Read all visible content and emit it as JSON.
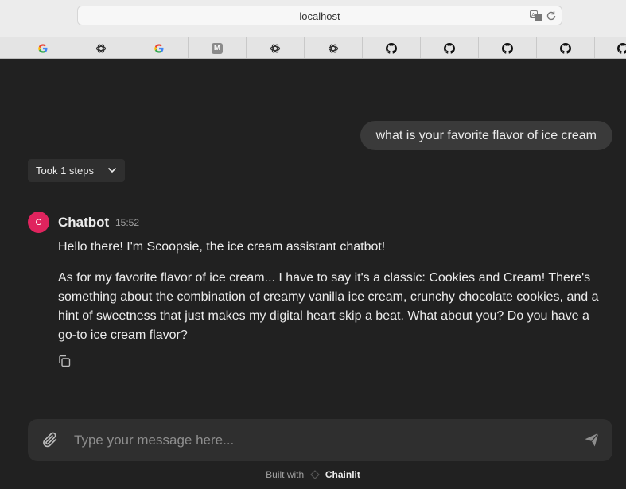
{
  "browser": {
    "url": "localhost",
    "bookmarks": [
      {
        "icon": "google-icon"
      },
      {
        "icon": "openai-icon"
      },
      {
        "icon": "google-icon"
      },
      {
        "icon": "m-icon",
        "letter": "M"
      },
      {
        "icon": "openai-icon"
      },
      {
        "icon": "openai-icon"
      },
      {
        "icon": "github-icon"
      },
      {
        "icon": "github-icon"
      },
      {
        "icon": "github-icon"
      },
      {
        "icon": "github-icon"
      },
      {
        "icon": "github-icon"
      }
    ]
  },
  "chat": {
    "user_message": "what is your favorite flavor of ice cream",
    "steps_label": "Took 1 steps",
    "bot": {
      "avatar_letter": "C",
      "author": "Chatbot",
      "time": "15:52",
      "paragraph1": "Hello there! I'm Scoopsie, the ice cream assistant chatbot!",
      "paragraph2": "As for my favorite flavor of ice cream... I have to say it's a classic: Cookies and Cream! There's something about the combination of creamy vanilla ice cream, crunchy chocolate cookies, and a hint of sweetness that just makes my digital heart skip a beat. What about you? Do you have a go-to ice cream flavor?"
    }
  },
  "composer": {
    "placeholder": "Type your message here..."
  },
  "footer": {
    "built_with": "Built with",
    "brand": "Chainlit"
  },
  "colors": {
    "background": "#212121",
    "avatar": "#e0245e",
    "bubble": "#3a3a3a"
  }
}
